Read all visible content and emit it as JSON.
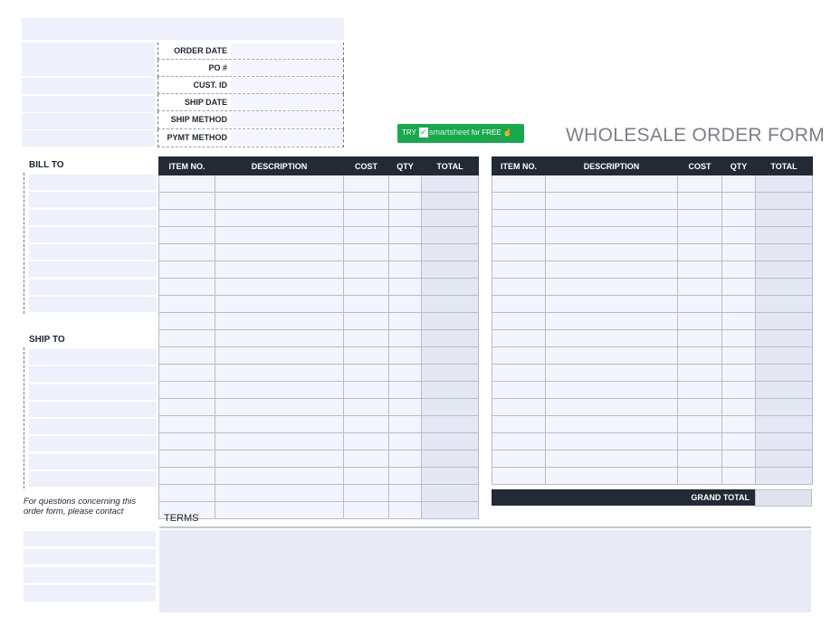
{
  "form": {
    "title": "WHOLESALE ORDER FORM",
    "header_fields": [
      "ORDER DATE",
      "PO #",
      "CUST. ID",
      "SHIP DATE",
      "SHIP METHOD",
      "PYMT METHOD"
    ],
    "bill_to_label": "BILL TO",
    "ship_to_label": "SHIP TO",
    "contact_note": "For questions concerning this order form, please contact",
    "terms_label": "TERMS",
    "grand_total_label": "GRAND TOTAL"
  },
  "promo": {
    "try": "TRY",
    "brand": "smartsheet",
    "suffix": "for FREE"
  },
  "tables": {
    "columns": [
      "ITEM NO.",
      "DESCRIPTION",
      "COST",
      "QTY",
      "TOTAL"
    ]
  },
  "colors": {
    "header_dark": "#222a35",
    "field_fill": "#eef0fb",
    "total_col_fill": "#e4e7f4",
    "promo_green": "#1aa84f",
    "title_gray": "#7b7f86"
  }
}
